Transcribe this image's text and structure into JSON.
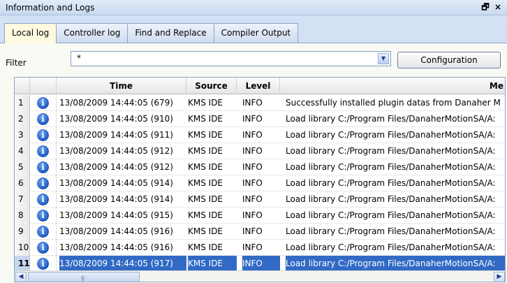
{
  "window": {
    "title": "Information and Logs",
    "float_icon": "restore-window-icon",
    "close_icon": "close-icon",
    "float_glyph": "🗗",
    "close_glyph": "×"
  },
  "tabs": [
    {
      "label": "Local log",
      "active": true
    },
    {
      "label": "Controller log",
      "active": false
    },
    {
      "label": "Find and Replace",
      "active": false
    },
    {
      "label": "Compiler Output",
      "active": false
    }
  ],
  "filter": {
    "label": "Filter",
    "value": "*",
    "dropdown_glyph": "▼"
  },
  "config_button": {
    "label": "Configuration"
  },
  "grid": {
    "columns": [
      "",
      "",
      "Time",
      "Source",
      "Level",
      "Me"
    ],
    "rows": [
      {
        "n": "1",
        "time": "13/08/2009 14:44:05 (679)",
        "source": "KMS IDE",
        "level": "INFO",
        "message": "Successfully installed plugin datas from Danaher M"
      },
      {
        "n": "2",
        "time": "13/08/2009 14:44:05 (910)",
        "source": "KMS IDE",
        "level": "INFO",
        "message": "Load library C:/Program Files/DanaherMotionSA/A:"
      },
      {
        "n": "3",
        "time": "13/08/2009 14:44:05 (911)",
        "source": "KMS IDE",
        "level": "INFO",
        "message": "Load library C:/Program Files/DanaherMotionSA/A:"
      },
      {
        "n": "4",
        "time": "13/08/2009 14:44:05 (912)",
        "source": "KMS IDE",
        "level": "INFO",
        "message": "Load library C:/Program Files/DanaherMotionSA/A:"
      },
      {
        "n": "5",
        "time": "13/08/2009 14:44:05 (912)",
        "source": "KMS IDE",
        "level": "INFO",
        "message": "Load library C:/Program Files/DanaherMotionSA/A:"
      },
      {
        "n": "6",
        "time": "13/08/2009 14:44:05 (914)",
        "source": "KMS IDE",
        "level": "INFO",
        "message": "Load library C:/Program Files/DanaherMotionSA/A:"
      },
      {
        "n": "7",
        "time": "13/08/2009 14:44:05 (914)",
        "source": "KMS IDE",
        "level": "INFO",
        "message": "Load library C:/Program Files/DanaherMotionSA/A:"
      },
      {
        "n": "8",
        "time": "13/08/2009 14:44:05 (915)",
        "source": "KMS IDE",
        "level": "INFO",
        "message": "Load library C:/Program Files/DanaherMotionSA/A:"
      },
      {
        "n": "9",
        "time": "13/08/2009 14:44:05 (916)",
        "source": "KMS IDE",
        "level": "INFO",
        "message": "Load library C:/Program Files/DanaherMotionSA/A:"
      },
      {
        "n": "10",
        "time": "13/08/2009 14:44:05 (916)",
        "source": "KMS IDE",
        "level": "INFO",
        "message": "Load library C:/Program Files/DanaherMotionSA/A:"
      },
      {
        "n": "11",
        "time": "13/08/2009 14:44:05 (917)",
        "source": "KMS IDE",
        "level": "INFO",
        "message": "Load library C:/Program Files/DanaherMotionSA/A:",
        "selected": true
      }
    ],
    "row_icon": "info-icon",
    "row_icon_glyph": "i"
  },
  "scrollbar": {
    "left_glyph": "◀",
    "right_glyph": "▶",
    "grip_glyph": "|||"
  },
  "colors": {
    "selection": "#316ac5",
    "panel_bg": "#d4e1f5",
    "active_tab": "#fefae0"
  }
}
